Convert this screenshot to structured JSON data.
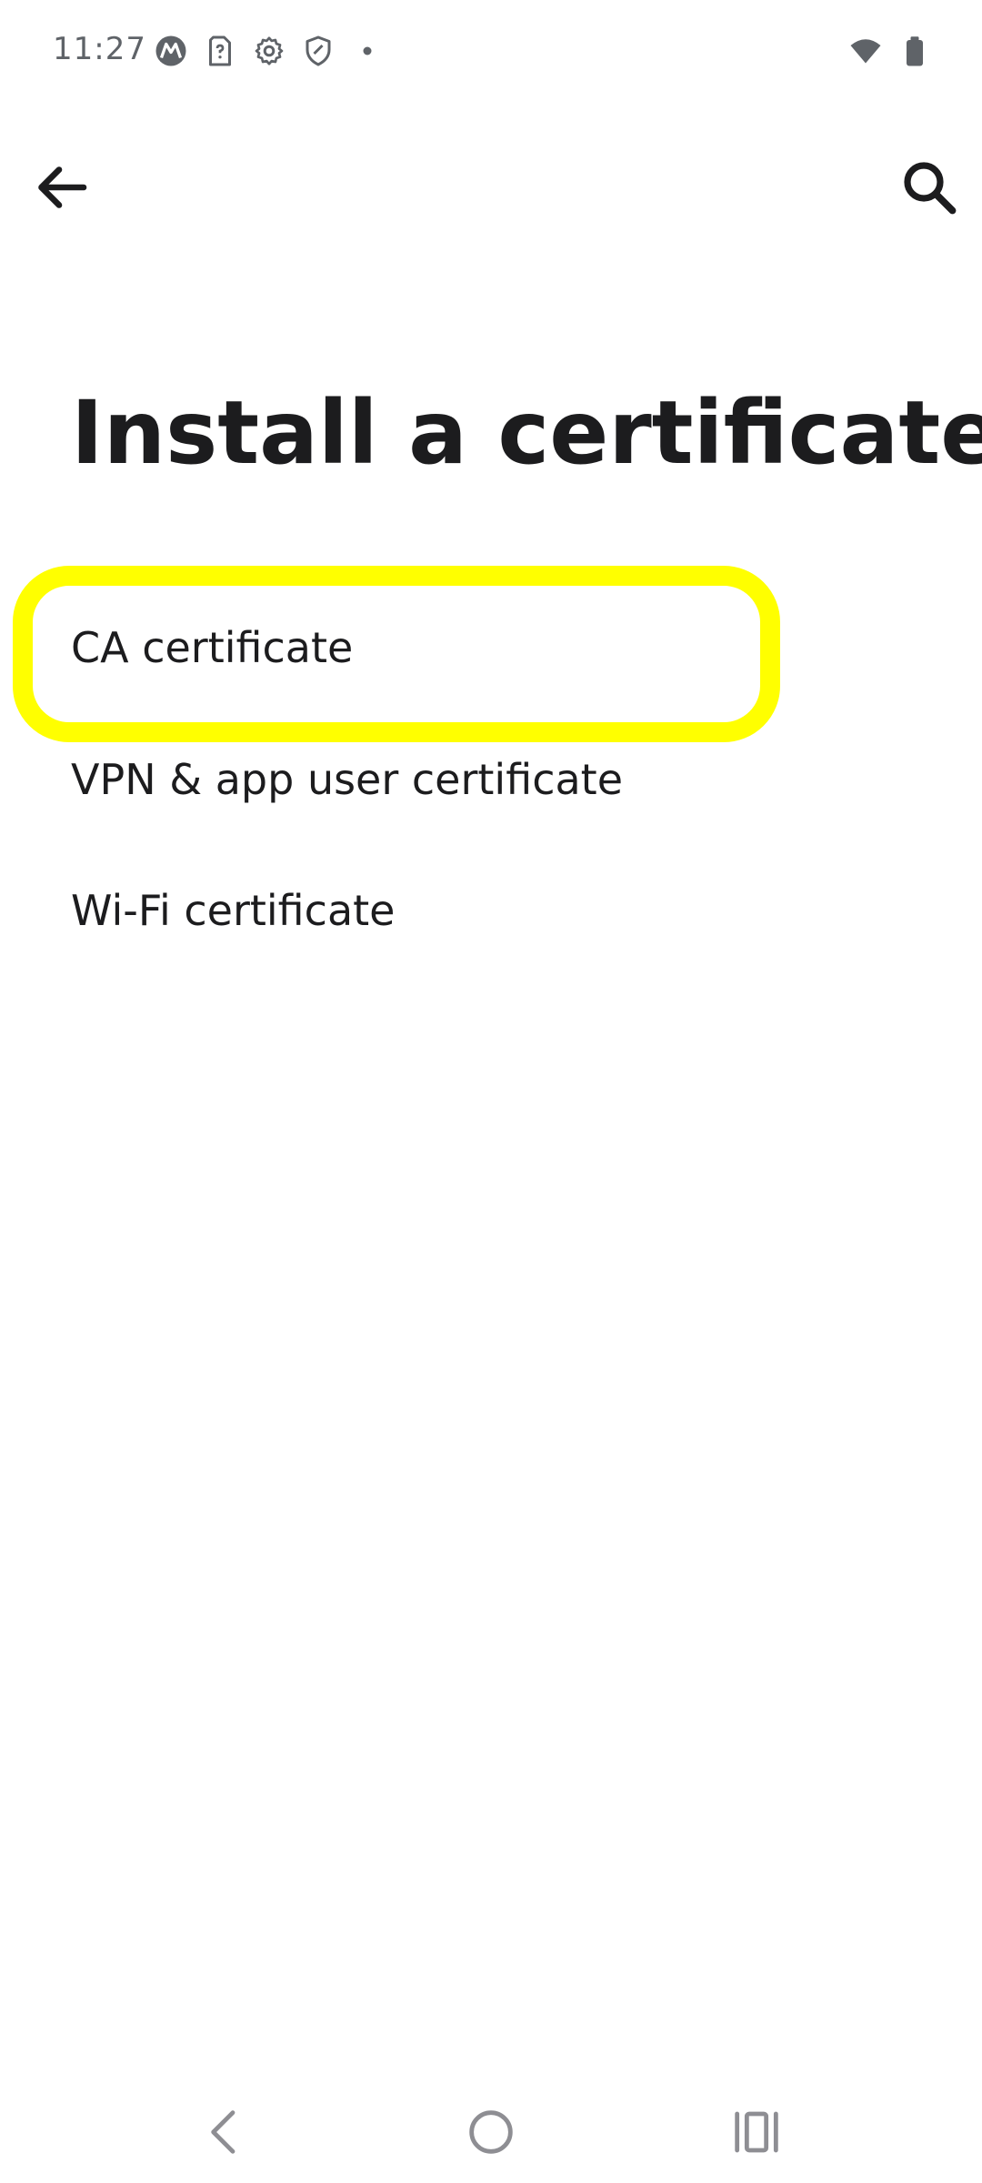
{
  "status_bar": {
    "time": "11:27",
    "icons": [
      "motorola-icon",
      "sim-unknown-icon",
      "settings-gear-icon",
      "shield-icon",
      "notification-dot-icon"
    ],
    "right_icons": [
      "wifi-icon",
      "battery-icon"
    ]
  },
  "app_bar": {
    "back_icon": "arrow-left-icon",
    "search_icon": "search-icon"
  },
  "page": {
    "title": "Install a certificate"
  },
  "list": {
    "items": [
      {
        "label": "CA certificate",
        "highlighted": true
      },
      {
        "label": "VPN & app user certificate",
        "highlighted": false
      },
      {
        "label": "Wi-Fi certificate",
        "highlighted": false
      }
    ]
  },
  "nav_bar": {
    "icons": [
      "nav-back-icon",
      "nav-home-icon",
      "nav-recents-icon"
    ]
  },
  "colors": {
    "highlight": "#ffff00",
    "text": "#1c1c1e",
    "status_text": "#5f6368",
    "background": "#ffffff"
  }
}
